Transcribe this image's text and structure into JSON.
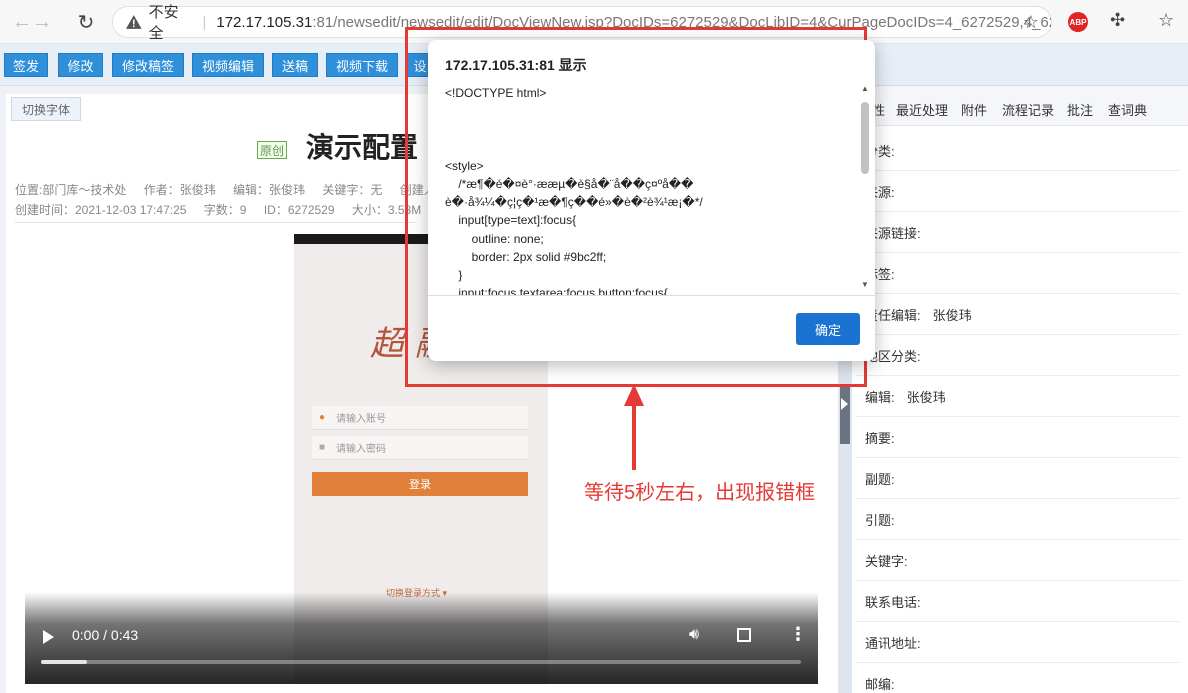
{
  "browser": {
    "insecure_label": "不安全",
    "url_host": "172.17.105.31",
    "url_rest": ":81/newsedit/newsedit/edit/DocViewNew.jsp?DocIDs=6272529&DocLibID=4&CurPageDocIDs=4_6272529,4_62...",
    "abp_label": "ABP",
    "icons": [
      "back-icon",
      "forward-icon",
      "reload-icon",
      "warning-icon",
      "star-add-icon",
      "abp-icon",
      "extensions-icon",
      "favorites-icon"
    ]
  },
  "toolbar": {
    "buttons": [
      "签发",
      "修改",
      "修改稿签",
      "视频编辑",
      "送稿",
      "视频下载",
      "设"
    ]
  },
  "doc": {
    "switch_font": "切换字体",
    "original_badge": "原创",
    "title": "演示配置",
    "meta1": {
      "location": "位置:部门库～技术处",
      "author": "作者：张俊玮",
      "editor": "编辑：张俊玮",
      "keywords": "关键字：无",
      "creator": "创建人："
    },
    "meta2": {
      "created": "创建时间：2021-12-03 17:47:25",
      "words": "字数：9",
      "id": "ID：6272529",
      "size": "大小：3.58M"
    }
  },
  "video": {
    "logo": "超 融",
    "account_placeholder": "请输入账号",
    "password_placeholder": "请输入密码",
    "login_button": "登录",
    "switch_login": "切换登录方式 ▾",
    "time": "0:00 / 0:43",
    "progress": 0.06
  },
  "right_panel": {
    "tabs": [
      "性",
      "最近处理",
      "附件",
      "流程记录",
      "批注",
      "查词典"
    ],
    "fields": [
      {
        "label": "分类:",
        "value": ""
      },
      {
        "label": "来源:",
        "value": ""
      },
      {
        "label": "来源链接:",
        "value": ""
      },
      {
        "label": "标签:",
        "value": ""
      },
      {
        "label": "责任编辑:",
        "value": "张俊玮"
      },
      {
        "label": "地区分类:",
        "value": ""
      },
      {
        "label": "编辑:",
        "value": "张俊玮"
      },
      {
        "label": "摘要:",
        "value": ""
      },
      {
        "label": "副题:",
        "value": ""
      },
      {
        "label": "引题:",
        "value": ""
      },
      {
        "label": "关键字:",
        "value": ""
      },
      {
        "label": "联系电话:",
        "value": ""
      },
      {
        "label": "通讯地址:",
        "value": ""
      },
      {
        "label": "邮编:",
        "value": ""
      }
    ]
  },
  "dialog": {
    "title": "172.17.105.31:81 显示",
    "content": "<!DOCTYPE html>\n\n\n\n<style>\n    /*æ¶�é�¤è°·ææµ�è§å�¨å��ç¤ºå��\nè�·å¾¼�ç¦ç�¹æ�¶ç��é»�è�²è¾¹æ¡�*/\n    input[type=text]:focus{\n        outline: none;\n        border: 2px solid #9bc2ff;\n    }\n    input:focus,textarea:focus,button:focus{",
    "ok_button": "确定"
  },
  "annotation": {
    "text": "等待5秒左右，出现报错框",
    "color": "#e53935"
  },
  "colors": {
    "toolbar_button": "#2f8fd8",
    "dialog_button": "#1a73d0"
  }
}
